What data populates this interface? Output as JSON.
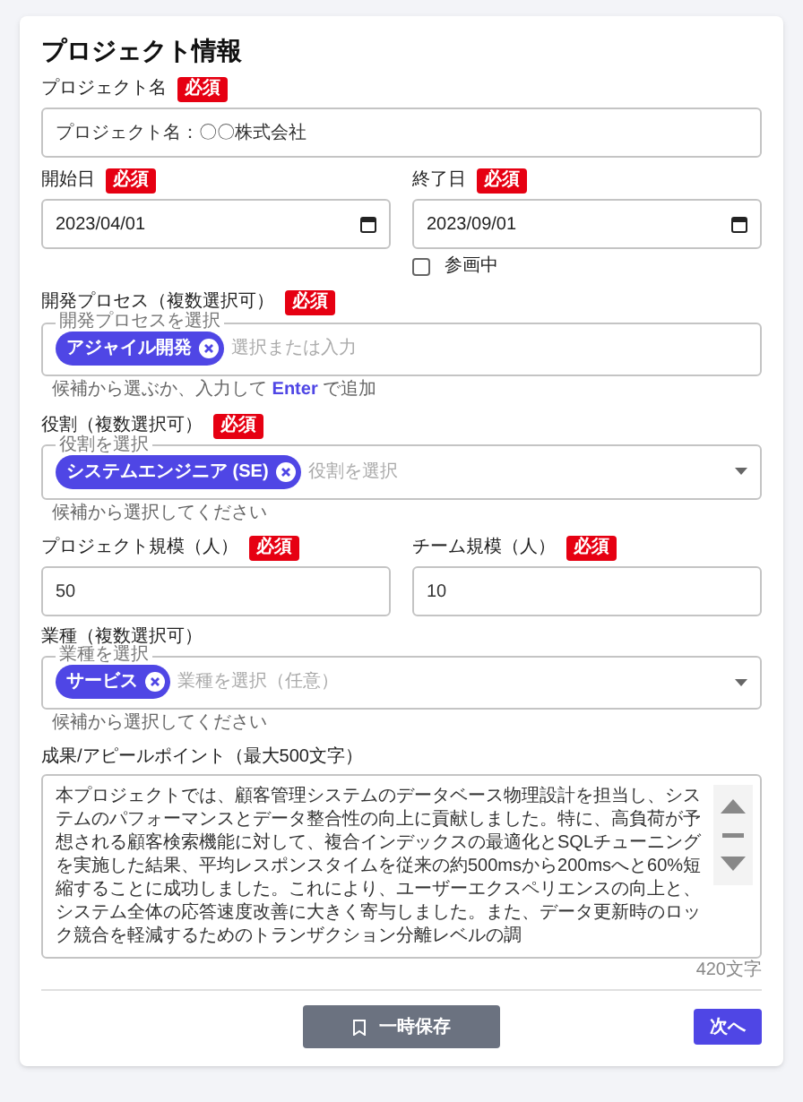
{
  "title": "プロジェクト情報",
  "rows": [
    [
      {
        "kind": "text",
        "label": "プロジェクト名",
        "badge": "必須",
        "value": "プロジェクト名：〇〇株式会社"
      }
    ],
    [
      {
        "kind": "date",
        "label": "開始日",
        "badge": "必須",
        "value": "2023/04/01"
      },
      {
        "kind": "date",
        "label": "終了日",
        "badge": "必須",
        "value": "2023/09/01"
      }
    ],
    [
      {
        "kind": "spacer"
      },
      {
        "kind": "checkbox",
        "label": "参画中",
        "checked": false
      }
    ],
    [
      {
        "kind": "chips",
        "label": "開発プロセス（複数選択可）",
        "badge": "必須",
        "legend": "開発プロセスを選択",
        "chips": [
          "アジャイル開発"
        ],
        "placeholder": "選択または入力",
        "helper": "候補から選ぶか、入力して **Enter** で追加",
        "dropdown": false
      }
    ],
    [
      {
        "kind": "chips",
        "label": "役割（複数選択可）",
        "badge": "必須",
        "legend": "役割を選択",
        "chips": [
          "システムエンジニア (SE)"
        ],
        "placeholder": "役割を選択",
        "helper": "候補から選択してください",
        "dropdown": true
      }
    ],
    [
      {
        "kind": "text",
        "label": "プロジェクト規模（人）",
        "badge": "必須",
        "value": "50"
      },
      {
        "kind": "text",
        "label": "チーム規模（人）",
        "badge": "必須",
        "value": "10"
      }
    ],
    [
      {
        "kind": "chips",
        "label": "業種（複数選択可）",
        "legend": "業種を選択",
        "chips": [
          "サービス"
        ],
        "placeholder": "業種を選択（任意）",
        "helper": "候補から選択してください",
        "dropdown": true
      }
    ],
    [
      {
        "kind": "textarea",
        "label": "成果/アピールポイント（最大500文字）",
        "value": "本プロジェクトでは、顧客管理システムのデータベース物理設計を担当し、システムのパフォーマンスとデータ整合性の向上に貢献しました。特に、高負荷が予想される顧客検索機能に対して、複合インデックスの最適化とSQLチューニングを実施した結果、平均レスポンスタイムを従来の約500msから200msへと60%短縮することに成功しました。これにより、ユーザーエクスペリエンスの向上と、システム全体の応答速度改善に大きく寄与しました。また、データ更新時のロック競合を軽減するためのトランザクション分離レベルの調",
        "count": "420文字"
      }
    ]
  ],
  "buttons": {
    "save": "一時保存",
    "next": "次へ"
  }
}
